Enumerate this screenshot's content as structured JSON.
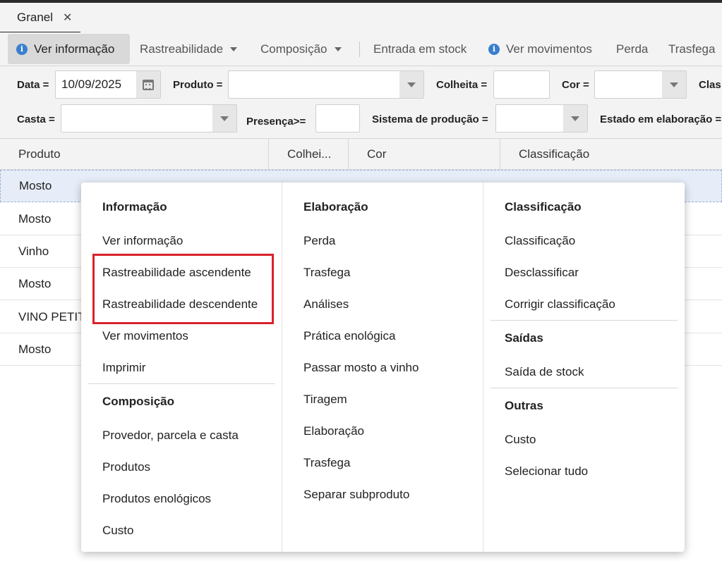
{
  "tab": {
    "label": "Granel",
    "close": "✕"
  },
  "toolbar": {
    "ver_informacao": "Ver informação",
    "rastreabilidade": "Rastreabilidade",
    "composicao": "Composição",
    "entrada_stock": "Entrada em stock",
    "ver_movimentos": "Ver movimentos",
    "perda": "Perda",
    "trasfega": "Trasfega"
  },
  "filters": {
    "data_label": "Data =",
    "data_value": "10/09/2025",
    "produto_label": "Produto =",
    "colheita_label": "Colheita =",
    "cor_label": "Cor =",
    "clas_label": "Clas",
    "casta_label": "Casta =",
    "presenca_label": "Presença>=",
    "sistema_label": "Sistema de produção =",
    "estado_label": "Estado em elaboração ="
  },
  "grid": {
    "columns": [
      "Produto",
      "Colhei...",
      "Cor",
      "Classificação"
    ],
    "rows": [
      "Mosto",
      "Mosto",
      "Vinho",
      "Mosto",
      "VINO PETIT",
      "Mosto"
    ]
  },
  "menu": {
    "informacao": {
      "title": "Informação",
      "items": [
        "Ver informação",
        "Rastreabilidade ascendente",
        "Rastreabilidade descendente",
        "Ver movimentos",
        "Imprimir"
      ]
    },
    "composicao": {
      "title": "Composição",
      "items": [
        "Provedor, parcela e casta",
        "Produtos",
        "Produtos enológicos",
        "Custo"
      ]
    },
    "elaboracao": {
      "title": "Elaboração",
      "items": [
        "Perda",
        "Trasfega",
        "Análises",
        "Prática enológica",
        "Passar mosto a vinho",
        "Tiragem",
        "Elaboração",
        "Trasfega",
        "Separar subproduto"
      ]
    },
    "classificacao": {
      "title": "Classificação",
      "items": [
        "Classificação",
        "Desclassificar",
        "Corrigir classificação"
      ]
    },
    "saidas": {
      "title": "Saídas",
      "items": [
        "Saída de stock"
      ]
    },
    "outras": {
      "title": "Outras",
      "items": [
        "Custo",
        "Selecionar tudo"
      ]
    }
  },
  "colors": {
    "accent": "#3a7fcf",
    "highlight": "#d9222a"
  }
}
